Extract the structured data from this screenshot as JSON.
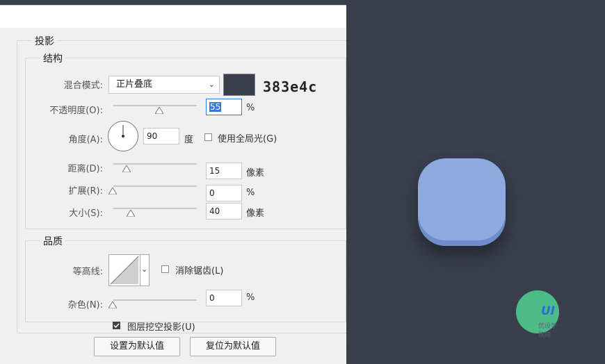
{
  "dialog": {
    "section_title": "投影",
    "structure": {
      "title": "结构",
      "blend_mode_label": "混合模式:",
      "blend_mode_value": "正片叠底",
      "color_hex_note": "383e4c",
      "color_swatch": "#383e4c",
      "opacity_label": "不透明度(O):",
      "opacity_value": "55",
      "opacity_unit": "%",
      "angle_label": "角度(A):",
      "angle_value": "90",
      "angle_unit": "度",
      "global_light_label": "使用全局光(G)",
      "global_light_checked": false,
      "distance_label": "距离(D):",
      "distance_value": "15",
      "distance_unit": "像素",
      "spread_label": "扩展(R):",
      "spread_value": "0",
      "spread_unit": "%",
      "size_label": "大小(S):",
      "size_value": "40",
      "size_unit": "像素"
    },
    "quality": {
      "title": "品质",
      "contour_label": "等高线:",
      "antialias_label": "消除锯齿(L)",
      "antialias_checked": false,
      "noise_label": "杂色(N):",
      "noise_value": "0",
      "noise_unit": "%"
    },
    "knockout_label": "图层挖空投影(U)",
    "knockout_checked": true,
    "set_default_button": "设置为默认值",
    "reset_default_button": "复位为默认值"
  },
  "canvas": {
    "background_color": "#383e4c",
    "icon_color": "#8ea9dd"
  },
  "watermark": {
    "logo_text": "UI",
    "sub_text": "优设学院网"
  }
}
